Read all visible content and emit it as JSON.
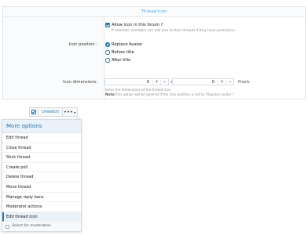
{
  "form": {
    "section_title": "Thread Icon",
    "allow_icon_label": "Allow icon in this forum ?",
    "allow_icon_hint": "If selected, members can add icon to their threads if they have permission.",
    "icon_position_label": "Icon position :",
    "position_options": [
      "Replace Avatar",
      "Before title",
      "After title"
    ],
    "selected_position": "Replace Avatar",
    "dimensions_label": "Icon dimensions:",
    "width_value": "0",
    "height_value": "0",
    "times_sign": "x",
    "unit": "Pixels",
    "dimensions_hint": "Enter the dimensions of the thread icon",
    "note_label": "Note:",
    "note_text": "This option will be ignored if the icon position is set to \"Replace avatar\".",
    "plus": "+",
    "minus": "−"
  },
  "toolbar": {
    "unwatch_label": "Unwatch",
    "more_label": "•••",
    "caret": "▾"
  },
  "menu": {
    "header": "More options",
    "items": [
      "Edit thread",
      "Close thread",
      "Stick thread",
      "Create poll",
      "Delete thread",
      "Move thread",
      "Manage reply bans",
      "Moderator actions",
      "Edit thread icon"
    ],
    "active_item": "Edit thread icon",
    "footer": "Select for moderation"
  },
  "colors": {
    "accent": "#2577b1",
    "title": "#47a7eb",
    "menu_header_bg": "#eaf1f8"
  }
}
